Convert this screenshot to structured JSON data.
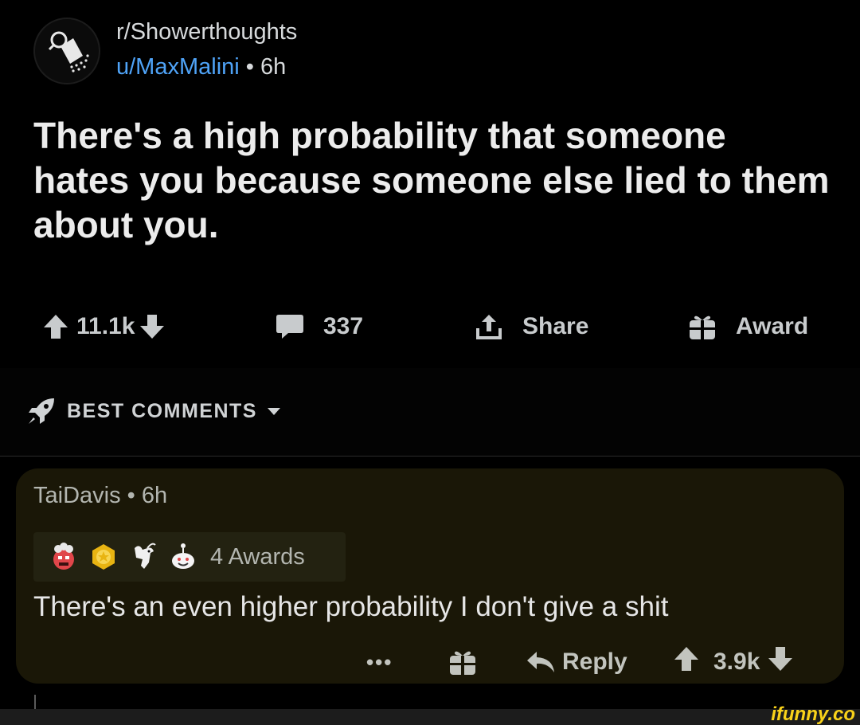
{
  "post": {
    "subreddit": "r/Showerthoughts",
    "author": "u/MaxMalini",
    "separator": "•",
    "age": "6h",
    "title": "There's a high probability that someone hates you because someone else lied to them about you.",
    "score": "11.1k",
    "comment_count": "337",
    "share_label": "Share",
    "award_label": "Award"
  },
  "sort": {
    "label": "BEST COMMENTS"
  },
  "comment": {
    "author": "TaiDavis",
    "separator": "•",
    "age": "6h",
    "awards_label": "4 Awards",
    "body": "There's an even higher probability I don't give a shit",
    "more_label": "•••",
    "reply_label": "Reply",
    "score": "3.9k"
  },
  "watermark": "ifunny.co",
  "colors": {
    "background": "#000000",
    "user_link": "#4fa3f7",
    "comment_highlight": "#1a1707",
    "watermark": "#f9d21a"
  },
  "icons": {
    "subreddit_avatar": "shower-head-icon",
    "upvote": "arrow-up-icon",
    "downvote": "arrow-down-icon",
    "comments": "speech-bubble-icon",
    "share": "share-upload-icon",
    "award": "gift-icon",
    "sort": "rocket-icon",
    "reply": "reply-arrow-icon"
  }
}
